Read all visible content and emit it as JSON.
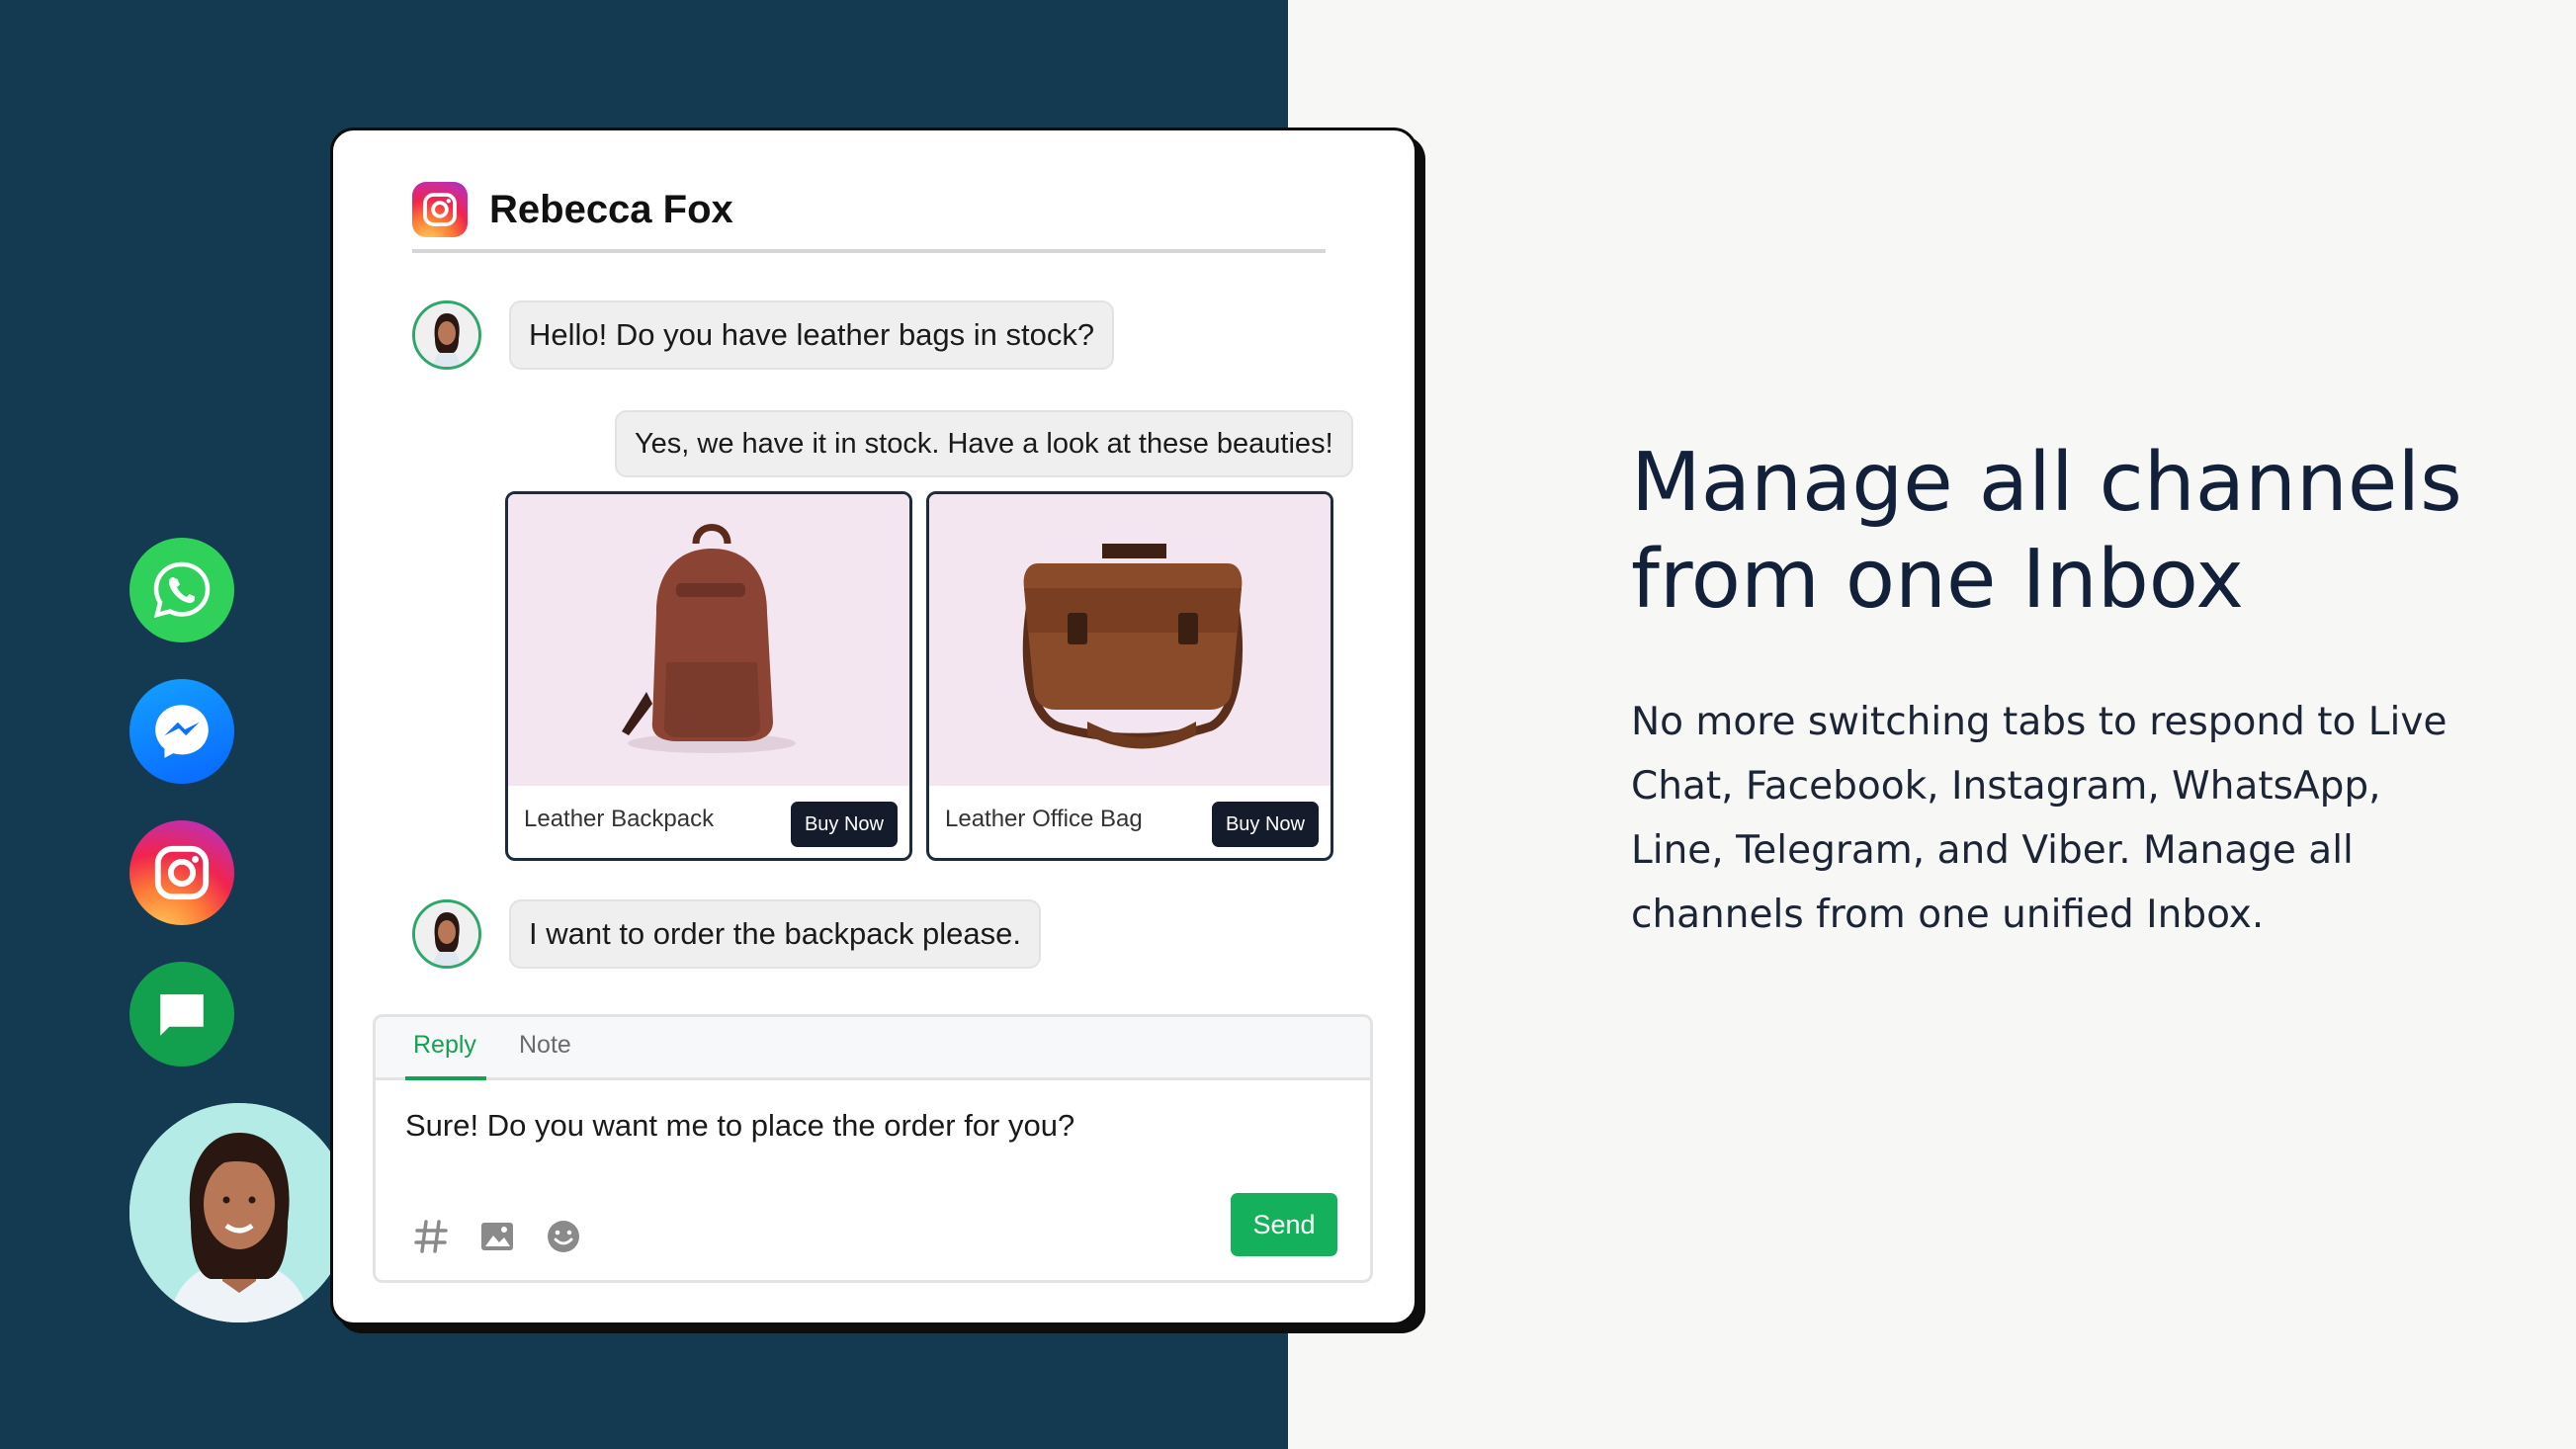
{
  "conversation": {
    "contact_name": "Rebecca Fox",
    "channel_icon": "instagram-icon",
    "messages": [
      {
        "from": "customer",
        "text": "Hello! Do you have leather bags in stock?"
      },
      {
        "from": "agent",
        "text": "Yes, we have it in stock. Have a look at these beauties!"
      },
      {
        "from": "customer",
        "text": "I want to order the backpack please."
      }
    ],
    "products": [
      {
        "name": "Leather Backpack",
        "button": "Buy Now"
      },
      {
        "name": "Leather Office Bag",
        "button": "Buy Now"
      }
    ]
  },
  "composer": {
    "tabs": [
      {
        "label": "Reply"
      },
      {
        "label": "Note"
      }
    ],
    "active_tab": "Reply",
    "text": "Sure! Do you want me to place the order for you?",
    "tools": [
      "hashtag-icon",
      "image-icon",
      "emoji-icon"
    ],
    "send_label": "Send"
  },
  "channels": [
    "whatsapp-icon",
    "messenger-icon",
    "instagram-icon",
    "chat-icon"
  ],
  "marketing": {
    "headline_lines": [
      "Manage all channels",
      "from one Inbox"
    ],
    "body_lines": [
      "No more switching tabs to respond to Live",
      "Chat, Facebook, Instagram, WhatsApp,",
      "Line, Telegram, and Viber. Manage all",
      "channels from one unified Inbox."
    ]
  },
  "colors": {
    "left_bg": "#133a50",
    "right_bg": "#f7f7f6",
    "accent_green": "#14b05b",
    "buy_button": "#141c2b",
    "product_bg": "#f4e6f0"
  }
}
